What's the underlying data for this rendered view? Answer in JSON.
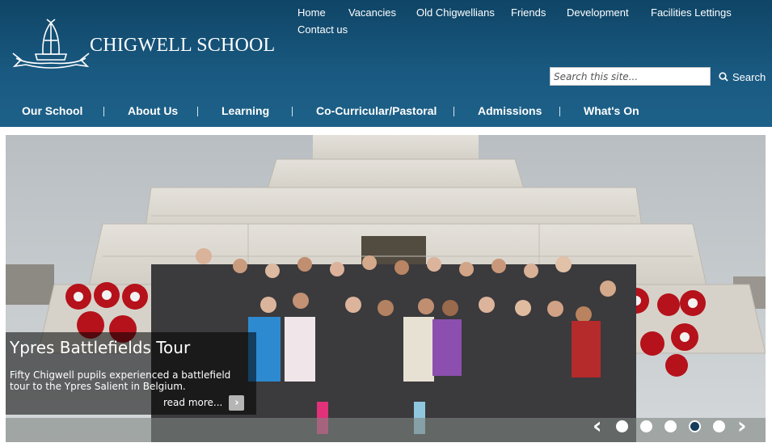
{
  "brand": {
    "name": "CHIGWELL SCHOOL",
    "crest_icon": "crest-mitre-icon"
  },
  "topnav": [
    {
      "label": "Home"
    },
    {
      "label": "Vacancies"
    },
    {
      "label": "Old Chigwellians"
    },
    {
      "label": "Friends"
    },
    {
      "label": "Development"
    },
    {
      "label": "Facilities Lettings"
    },
    {
      "label": "Contact us"
    }
  ],
  "search": {
    "placeholder": "Search this site...",
    "value": "",
    "button_label": "Search",
    "icon": "search-icon"
  },
  "mainnav": [
    {
      "label": "Our School"
    },
    {
      "label": "About Us"
    },
    {
      "label": "Learning"
    },
    {
      "label": "Co-Curricular/Pastoral"
    },
    {
      "label": "Admissions"
    },
    {
      "label": "What's On"
    }
  ],
  "slide": {
    "title": "Ypres Battlefields Tour",
    "body": "Fifty Chigwell pupils experienced a battlefield tour to the Ypres Salient in Belgium.",
    "read_more": "read more...",
    "read_more_icon": "chevron-right-icon",
    "total_slides": 5,
    "active_slide": 4,
    "prev_icon": "chevron-left-icon",
    "next_icon": "chevron-right-icon"
  },
  "colors": {
    "header": "#1a5a82",
    "accent_active_dot": "#163d5a"
  }
}
